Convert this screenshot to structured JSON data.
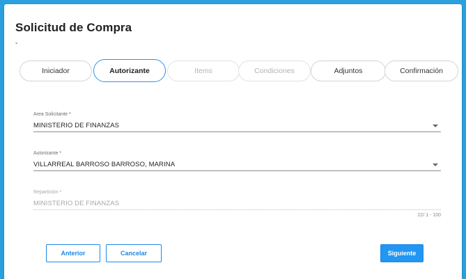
{
  "page": {
    "title": "Solicitud de Compra",
    "subtitle": "-"
  },
  "steps": [
    {
      "label": "Iniciador",
      "state": "normal"
    },
    {
      "label": "Autorizante",
      "state": "active"
    },
    {
      "label": "Items",
      "state": "disabled"
    },
    {
      "label": "Condiciones",
      "state": "disabled"
    },
    {
      "label": "Adjuntos",
      "state": "normal"
    },
    {
      "label": "Confirmación",
      "state": "normal"
    }
  ],
  "form": {
    "area": {
      "label": "Area Solicitante *",
      "value": "MINISTERIO DE FINANZAS"
    },
    "autorizante": {
      "label": "Autorizante *",
      "value": "VILLARREAL BARROSO BARROSO, MARINA"
    },
    "reparticion": {
      "label": "Repartición *",
      "value": "MINISTERIO DE FINANZAS",
      "counter": "22/ 1 - 100"
    }
  },
  "buttons": {
    "previous": "Anterior",
    "cancel": "Cancelar",
    "next": "Siguiente"
  },
  "colors": {
    "background": "#2aa1dd",
    "accent": "#2196f3"
  }
}
